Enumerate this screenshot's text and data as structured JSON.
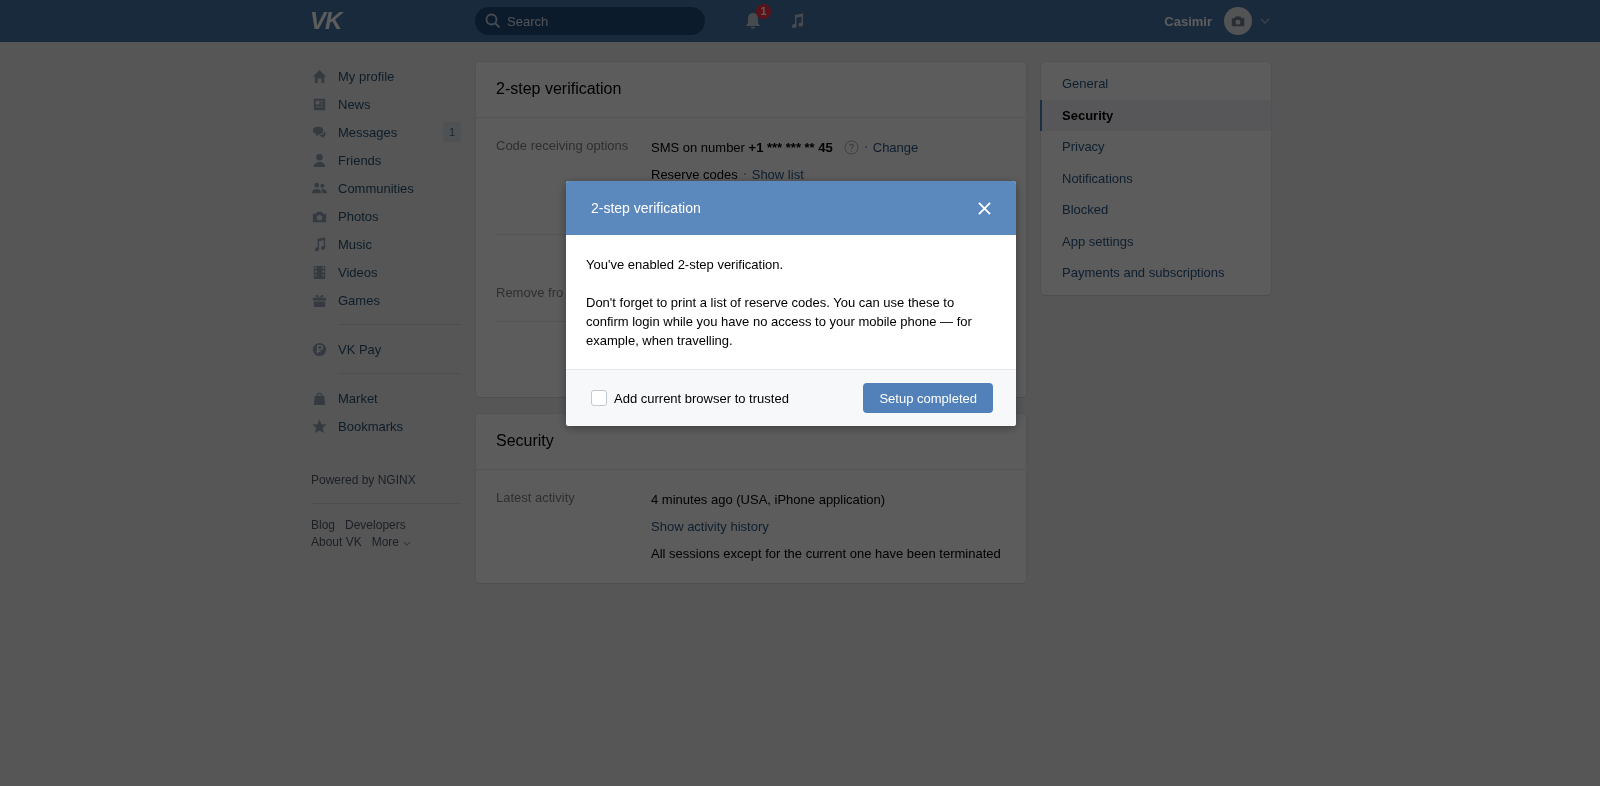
{
  "header": {
    "logo_text": "VK",
    "search": {
      "placeholder": "Search"
    },
    "notifications_badge": "1",
    "user_name": "Casimir"
  },
  "sidebar": {
    "groups": [
      [
        {
          "label": "My profile"
        },
        {
          "label": "News"
        },
        {
          "label": "Messages",
          "badge": "1"
        },
        {
          "label": "Friends"
        },
        {
          "label": "Communities"
        },
        {
          "label": "Photos"
        },
        {
          "label": "Music"
        },
        {
          "label": "Videos"
        },
        {
          "label": "Games"
        }
      ],
      [
        {
          "label": "VK Pay"
        }
      ],
      [
        {
          "label": "Market"
        },
        {
          "label": "Bookmarks"
        }
      ]
    ],
    "powered_by": "Powered by NGINX",
    "footer_links": [
      {
        "label": "Blog"
      },
      {
        "label": "Developers"
      },
      {
        "label": "About VK"
      },
      {
        "label": "More"
      }
    ]
  },
  "two_step_card": {
    "title": "2-step verification",
    "code_label": "Code receiving options",
    "sms_prefix": "SMS on number ",
    "phone": "+1 *** *** ** 45",
    "change_link": "Change",
    "reserve_label": "Reserve codes",
    "show_list_link": "Show list",
    "remove_label": "Remove fro"
  },
  "security_card": {
    "title": "Security",
    "activity_label": "Latest activity",
    "last_activity": "4 minutes ago (USA, iPhone application)",
    "history_link": "Show activity history",
    "sessions_note": "All sessions except for the current one have been terminated"
  },
  "settings_menu": {
    "items": [
      {
        "label": "General",
        "selected": false
      },
      {
        "label": "Security",
        "selected": true
      },
      {
        "label": "Privacy",
        "selected": false
      },
      {
        "label": "Notifications",
        "selected": false
      },
      {
        "label": "Blocked",
        "selected": false
      },
      {
        "label": "App settings",
        "selected": false
      },
      {
        "label": "Payments and subscriptions",
        "selected": false
      }
    ]
  },
  "modal": {
    "title": "2-step verification",
    "paragraphs": [
      "You've enabled 2-step verification.",
      "Don't forget to print a list of reserve codes. You can use these to confirm login while you have no access to your mobile phone — for example, when travelling."
    ],
    "checkbox": {
      "label": "Add current browser to trusted",
      "checked": false
    },
    "button": "Setup completed"
  }
}
